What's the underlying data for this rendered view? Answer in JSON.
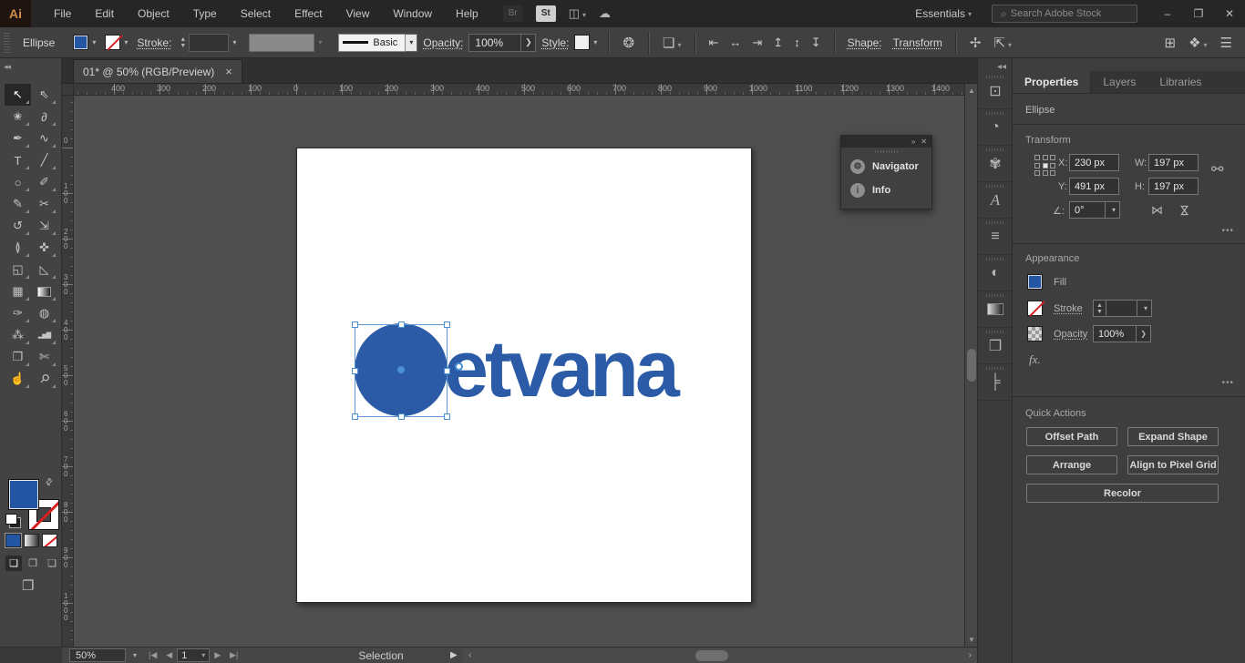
{
  "menubar": {
    "logo": "Ai",
    "items": [
      {
        "name": "menu-file",
        "label": "File"
      },
      {
        "name": "menu-edit",
        "label": "Edit"
      },
      {
        "name": "menu-object",
        "label": "Object"
      },
      {
        "name": "menu-type",
        "label": "Type"
      },
      {
        "name": "menu-select",
        "label": "Select"
      },
      {
        "name": "menu-effect",
        "label": "Effect"
      },
      {
        "name": "menu-view",
        "label": "View"
      },
      {
        "name": "menu-window",
        "label": "Window"
      },
      {
        "name": "menu-help",
        "label": "Help"
      }
    ],
    "badge_bridge": "Br",
    "badge_stock": "St",
    "layout_icon": "◫",
    "sync_icon": "☁",
    "workspace": "Essentials",
    "search_icon": "⌕",
    "search_placeholder": "Search Adobe Stock",
    "win_minimize": "–",
    "win_restore": "❐",
    "win_close": "✕"
  },
  "controlbar": {
    "tool_label": "Ellipse",
    "stroke_label": "Stroke:",
    "profile_name": "Basic",
    "opacity_label": "Opacity:",
    "opacity_value": "100%",
    "style_label": "Style:",
    "doc_setup_icon": "❂",
    "doc_icon": "❏",
    "align_icons": [
      {
        "name": "align-left-icon",
        "glyph": "⇤"
      },
      {
        "name": "align-h-center-icon",
        "glyph": "↔"
      },
      {
        "name": "align-right-icon",
        "glyph": "⇥"
      },
      {
        "name": "align-top-icon",
        "glyph": "↥"
      },
      {
        "name": "align-v-center-icon",
        "glyph": "↕"
      },
      {
        "name": "align-bottom-icon",
        "glyph": "↧"
      }
    ],
    "shape_label": "Shape:",
    "transform_label": "Transform",
    "expand_arrows_icon": "✢",
    "select_similar_icon": "⇱",
    "grid_icon": "⊞",
    "workspace_icon": "❖",
    "panel_menu_icon": "☰"
  },
  "tab": {
    "title": "01* @ 50% (RGB/Preview)",
    "close": "×"
  },
  "tools": [
    {
      "name": "selection-tool",
      "glyph": "↖",
      "selected": true
    },
    {
      "name": "direct-selection-tool",
      "glyph": "⇖"
    },
    {
      "name": "magic-wand-tool",
      "glyph": "✬"
    },
    {
      "name": "lasso-tool",
      "glyph": "∂"
    },
    {
      "name": "pen-tool",
      "glyph": "✒"
    },
    {
      "name": "curvature-tool",
      "glyph": "∿"
    },
    {
      "name": "type-tool",
      "glyph": "T"
    },
    {
      "name": "line-segment-tool",
      "glyph": "╱"
    },
    {
      "name": "ellipse-tool",
      "glyph": "○"
    },
    {
      "name": "paintbrush-tool",
      "glyph": "✐"
    },
    {
      "name": "shaper-tool",
      "glyph": "✎"
    },
    {
      "name": "scissors-tool",
      "glyph": "✂"
    },
    {
      "name": "rotate-tool",
      "glyph": "↺"
    },
    {
      "name": "scale-tool",
      "glyph": "⇲"
    },
    {
      "name": "width-tool",
      "glyph": "≬"
    },
    {
      "name": "puppet-warp-tool",
      "glyph": "✜"
    },
    {
      "name": "shape-builder-tool",
      "glyph": "◱"
    },
    {
      "name": "perspective-grid-tool",
      "glyph": "◺"
    },
    {
      "name": "mesh-tool",
      "glyph": "▦"
    },
    {
      "name": "gradient-tool",
      "glyph": "",
      "cls": "gradient"
    },
    {
      "name": "eyedropper-tool",
      "glyph": "✑"
    },
    {
      "name": "blend-tool",
      "glyph": "◍"
    },
    {
      "name": "symbol-sprayer-tool",
      "glyph": "⁂"
    },
    {
      "name": "graph-tool",
      "glyph": "▂▅▇",
      "cls": "small-g"
    },
    {
      "name": "artboard-tool",
      "glyph": "❐"
    },
    {
      "name": "slice-tool",
      "glyph": "✄"
    },
    {
      "name": "hand-tool",
      "glyph": "☝"
    },
    {
      "name": "zoom-tool",
      "glyph": "⚲",
      "cls": "rot45"
    }
  ],
  "toolbar_collapse": "◂◂",
  "rulers": {
    "horizontal": [
      "400",
      "300",
      "200",
      "100",
      "0",
      "100",
      "200",
      "300",
      "400",
      "500",
      "600",
      "700",
      "800",
      "900",
      "1000",
      "1100",
      "1200",
      "1300",
      "1400"
    ],
    "vertical": [
      "0",
      "100",
      "200",
      "300",
      "400",
      "500",
      "600",
      "700",
      "800",
      "900",
      "1000"
    ]
  },
  "canvas": {
    "logo_text": "etvana",
    "accent_blue": "#2b5ba6",
    "selection_blue": "#4a90d2"
  },
  "float_panel": {
    "expand": "»",
    "close": "✕",
    "items": [
      {
        "name": "navigator-item",
        "glyph": "☸",
        "label": "Navigator"
      },
      {
        "name": "info-item",
        "glyph": "i",
        "label": "Info"
      }
    ]
  },
  "dock": {
    "collapse": "◂◂",
    "icons": [
      {
        "name": "transform-panel-icon",
        "glyph": "⊡"
      },
      {
        "name": "asset-export-panel-icon",
        "glyph": "◔"
      },
      {
        "name": "color-panel-icon",
        "glyph": "✾"
      },
      {
        "name": "character-panel-icon",
        "glyph": "A",
        "cls": "serif-italic"
      },
      {
        "name": "stroke-panel-icon",
        "glyph": "≡"
      },
      {
        "name": "transparency-panel-icon",
        "glyph": "◐"
      },
      {
        "name": "gradient-panel-icon",
        "glyph": "",
        "cls": "gradient-box"
      },
      {
        "name": "pathfinder-panel-icon",
        "glyph": "❒"
      },
      {
        "name": "align-panel-icon",
        "glyph": "╞"
      }
    ]
  },
  "properties": {
    "tabs": [
      {
        "name": "tab-properties",
        "label": "Properties",
        "selected": true
      },
      {
        "name": "tab-layers",
        "label": "Layers"
      },
      {
        "name": "tab-libraries",
        "label": "Libraries"
      }
    ],
    "object_type": "Ellipse",
    "transform": {
      "title": "Transform",
      "x_label": "X:",
      "x_value": "230 px",
      "y_label": "Y:",
      "y_value": "491 px",
      "w_label": "W:",
      "w_value": "197 px",
      "h_label": "H:",
      "h_value": "197 px",
      "angle_icon": "∠:",
      "angle_value": "0°",
      "link_icon": "⚯",
      "flip_h_icon": "⋈",
      "flip_v_icon": "⋈"
    },
    "appearance": {
      "title": "Appearance",
      "fill_label": "Fill",
      "stroke_label": "Stroke",
      "opacity_label": "Opacity",
      "opacity_value": "100%",
      "fx_label": "fx."
    },
    "quick": {
      "title": "Quick Actions",
      "buttons": [
        {
          "name": "offset-path-button",
          "label": "Offset Path"
        },
        {
          "name": "expand-shape-button",
          "label": "Expand Shape"
        },
        {
          "name": "arrange-button",
          "label": "Arrange"
        },
        {
          "name": "align-to-pixel-grid-button",
          "label": "Align to Pixel Grid"
        },
        {
          "name": "recolor-button",
          "label": "Recolor"
        }
      ]
    },
    "more": "•••"
  },
  "statusbar": {
    "zoom": "50%",
    "first": "|◀",
    "prev": "◀",
    "artboard": "1",
    "next": "▶",
    "last": "▶|",
    "status": "Selection",
    "play": "▶",
    "left_arrow": "‹",
    "right_arrow": "›"
  }
}
